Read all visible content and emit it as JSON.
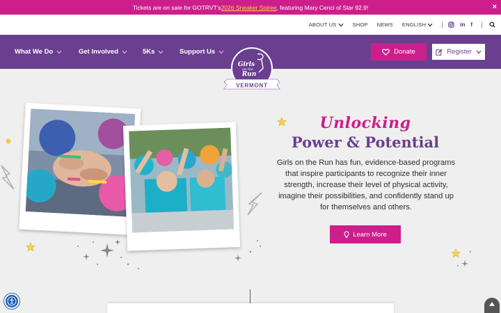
{
  "announcement": {
    "before": "Tickets are on sale for GOTRVT's ",
    "link": "2026 Sneaker Soiree",
    "after": ", featuring Mary Cenci of Star 92.9!",
    "close": "×"
  },
  "utility_nav": {
    "about": "ABOUT US",
    "shop": "SHOP",
    "news": "NEWS",
    "language": "ENGLISH",
    "social_icons": [
      "instagram-icon",
      "linkedin-icon",
      "facebook-icon"
    ],
    "linkedin_glyph": "in",
    "facebook_glyph": "f"
  },
  "main_nav": {
    "items": [
      {
        "label": "What We Do"
      },
      {
        "label": "Get Involved"
      },
      {
        "label": "5Ks"
      },
      {
        "label": "Support Us"
      }
    ],
    "donate": "Donate",
    "register": "Register"
  },
  "logo": {
    "line1": "Girls",
    "line2": "on the",
    "line3": "Run",
    "banner": "VERMONT"
  },
  "hero": {
    "script_title": "Unlocking",
    "title": "Power & Potential",
    "body": "Girls on the Run has fun, evidence-based programs that inspire participants to recognize their inner strength, increase their level of physical activity, imagine their possibilities, and confidently stand up for themselves and others.",
    "cta": "Learn More"
  },
  "colors": {
    "announce_bg": "#cc1f8c",
    "nav_bg": "#6a3f8f",
    "accent_pink": "#cc1f8c",
    "page_bg": "#f0efef"
  }
}
